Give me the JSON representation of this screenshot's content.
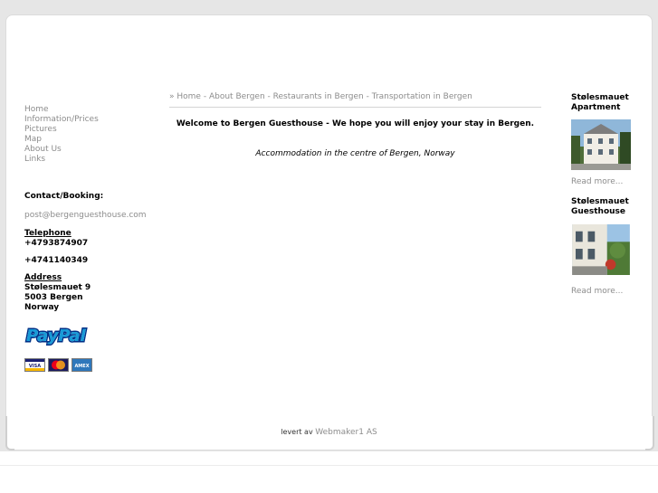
{
  "nav": {
    "items": [
      "Home",
      "Information/Prices",
      "Pictures",
      "Map",
      "About Us",
      "Links"
    ]
  },
  "contact": {
    "title": "Contact/Booking:",
    "email": "post@bergenguesthouse.com",
    "telephone_label": "Telephone",
    "phone1": "+4793874907",
    "phone2": "+4741140349",
    "address_label": "Address",
    "address": [
      "Stølesmauet 9",
      "5003 Bergen",
      "Norway"
    ]
  },
  "payment": {
    "paypal_text": "PayPal",
    "cards": [
      "VISA",
      "MasterCard",
      "AMEX"
    ]
  },
  "breadcrumb": {
    "prefix": "»",
    "items": [
      "Home",
      "About Bergen",
      "Restaurants in Bergen",
      "Transportation in Bergen"
    ],
    "separator": "-"
  },
  "main": {
    "welcome": "Welcome to Bergen Guesthouse - We hope you will enjoy your stay in Bergen.",
    "subtitle": "Accommodation in the centre of Bergen, Norway"
  },
  "sidebar": {
    "items": [
      {
        "title_line1": "Stølesmauet",
        "title_line2": "Apartment",
        "read_more": "Read more..."
      },
      {
        "title_line1": "Stølesmauet",
        "title_line2": "Guesthouse",
        "read_more": "Read more..."
      }
    ]
  },
  "footer": {
    "prefix": "levert av",
    "link": "Webmaker1 AS"
  },
  "colors": {
    "background": "#e6e6e6",
    "link_gray": "#8c8c8c",
    "paypal_blue": "#003087",
    "paypal_light_blue": "#179bd7"
  }
}
